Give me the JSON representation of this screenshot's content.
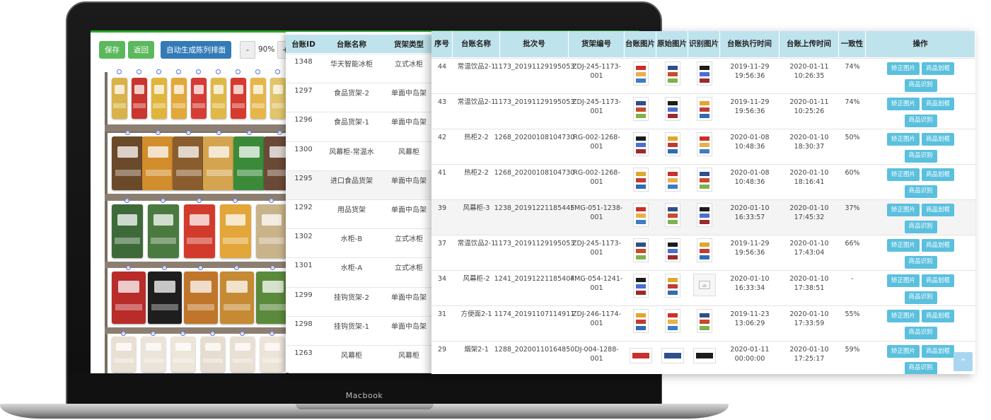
{
  "device": {
    "label": "Macbook"
  },
  "toolbar": {
    "save": "保存",
    "back": "返回",
    "auto_generate": "自动生成陈列排面",
    "zoom_out": "-",
    "zoom_value": "90%",
    "zoom_in": "+"
  },
  "ledger_table": {
    "headers": [
      "台账ID",
      "台账名称",
      "货架类型"
    ],
    "rows": [
      [
        "1348",
        "华天智能冰柜",
        "立式冰柜"
      ],
      [
        "1297",
        "食品货架-2",
        "单面中岛架"
      ],
      [
        "1296",
        "食品货架-1",
        "单面中岛架"
      ],
      [
        "1300",
        "风幕柜-常温水",
        "风幕柜"
      ],
      [
        "1295",
        "进口食品货架",
        "单面中岛架"
      ],
      [
        "1292",
        "用品货架",
        "单面中岛架"
      ],
      [
        "1302",
        "水柜-B",
        "立式冰柜"
      ],
      [
        "1301",
        "水柜-A",
        "立式冰柜"
      ],
      [
        "1299",
        "挂钩货架-2",
        "单面中岛架"
      ],
      [
        "1298",
        "挂钩货架-1",
        "单面中岛架"
      ],
      [
        "1263",
        "风幕柜",
        "风幕柜"
      ]
    ]
  },
  "records_table": {
    "headers": [
      "序号",
      "台账名称",
      "批次号",
      "货架编号",
      "台账图片",
      "原始图片",
      "识别图片",
      "台账执行时间",
      "台账上传时间",
      "一致性",
      "操作"
    ],
    "actions": [
      "矫正图片",
      "商品划框",
      "商品识别"
    ],
    "rows": [
      {
        "id": "44",
        "name": "常温饮品2-1",
        "batch": "1173_20191129195053",
        "shelf": "ZDJ-245-1173-001",
        "exec_date": "2019-11-29",
        "exec_time": "19:56:36",
        "up_date": "2020-01-11",
        "up_time": "10:26:35",
        "consistency": "74%"
      },
      {
        "id": "43",
        "name": "常温饮品2-1",
        "batch": "1173_20191129195053",
        "shelf": "ZDJ-245-1173-001",
        "exec_date": "2019-11-29",
        "exec_time": "19:56:36",
        "up_date": "2020-01-11",
        "up_time": "10:25:26",
        "consistency": "74%"
      },
      {
        "id": "42",
        "name": "热柜2-2",
        "batch": "1268_20200108104730",
        "shelf": "RG-002-1268-001",
        "exec_date": "2020-01-08",
        "exec_time": "10:48:36",
        "up_date": "2020-01-10",
        "up_time": "18:30:37",
        "consistency": "50%"
      },
      {
        "id": "41",
        "name": "热柜2-2",
        "batch": "1268_20200108104730",
        "shelf": "RG-002-1268-001",
        "exec_date": "2020-01-08",
        "exec_time": "10:48:36",
        "up_date": "2020-01-10",
        "up_time": "18:16:41",
        "consistency": "60%"
      },
      {
        "id": "39",
        "name": "风幕柜-3",
        "batch": "1238_20191221185445",
        "shelf": "FMG-051-1238-",
        "shelf2": "001",
        "exec_date": "2020-01-10",
        "exec_time": "16:33:57",
        "up_date": "2020-01-10",
        "up_time": "17:45:32",
        "consistency": "37%"
      },
      {
        "id": "37",
        "name": "常温饮品2-1",
        "batch": "1173_20191129195053",
        "shelf": "ZDJ-245-1173-001",
        "exec_date": "2019-11-29",
        "exec_time": "19:56:36",
        "up_date": "2020-01-10",
        "up_time": "17:43:04",
        "consistency": "66%"
      },
      {
        "id": "34",
        "name": "风幕柜-2",
        "batch": "1241_20191221185404",
        "shelf": "FMG-054-1241-",
        "shelf2": "001",
        "exec_date": "2020-01-10",
        "exec_time": "16:33:34",
        "up_date": "2020-01-10",
        "up_time": "17:38:51",
        "consistency": "-"
      },
      {
        "id": "31",
        "name": "方便面2-1",
        "batch": "1174_20191107114911",
        "shelf": "ZDJ-246-1174-001",
        "exec_date": "2019-11-23",
        "exec_time": "13:06:29",
        "up_date": "2020-01-10",
        "up_time": "17:33:59",
        "consistency": "55%"
      },
      {
        "id": "29",
        "name": "烟架2-1",
        "batch": "1288_20200110164850",
        "shelf": "DJ-004-1288-001",
        "exec_date": "2020-01-11",
        "exec_time": "00:00:00",
        "up_date": "2020-01-10",
        "up_time": "17:25:17",
        "consistency": "59%"
      }
    ]
  },
  "back_to_top": "⌃"
}
